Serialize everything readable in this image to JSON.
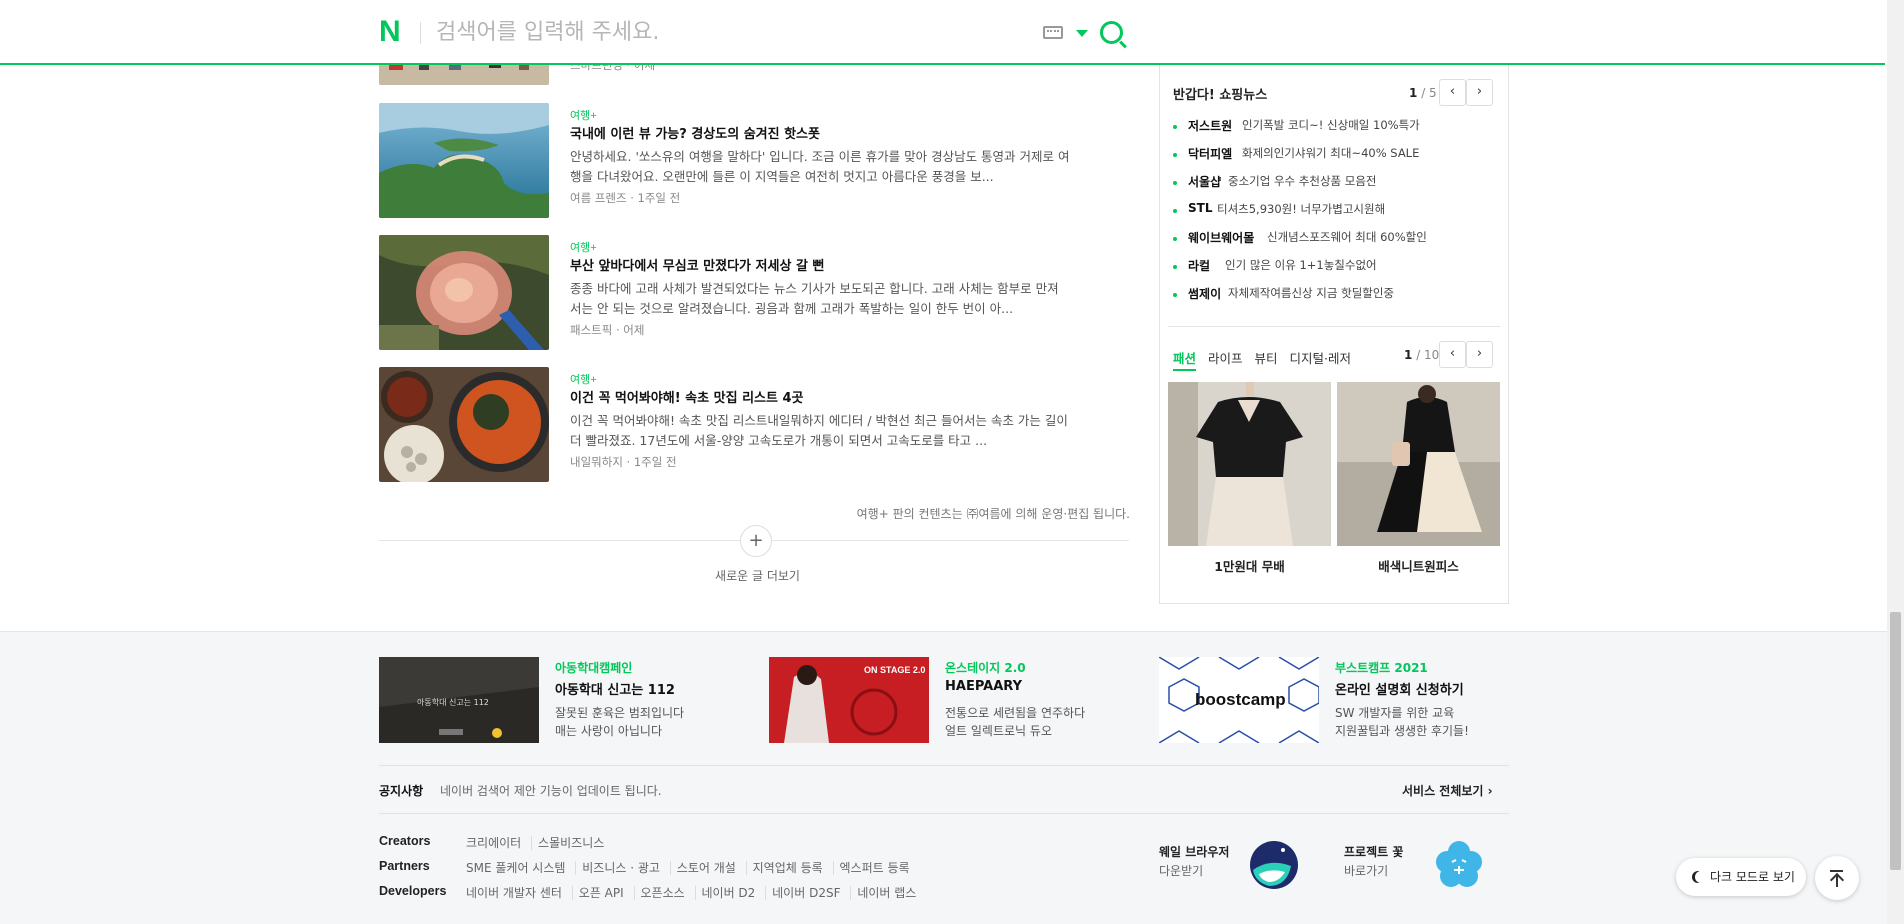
{
  "search": {
    "logo": "N",
    "placeholder": "검색어를 입력해 주세요."
  },
  "articles": [
    {
      "category": "",
      "title": "",
      "desc": "",
      "meta": "스마트런닝 · 어제"
    },
    {
      "category": "여행+",
      "title": "국내에 이런 뷰 가능? 경상도의 숨겨진 핫스폿",
      "desc": "안녕하세요. '쏘스유의 여행을 말하다' 입니다. 조금 이른 휴가를 맞아 경상남도 통영과 거제로 여행을 다녀왔어요. 오랜만에 들른 이 지역들은 여전히 멋지고 아름다운 풍경을 보...",
      "meta": "여름 프렌즈 · 1주일 전"
    },
    {
      "category": "여행+",
      "title": "부산 앞바다에서 무심코 만졌다가 저세상 갈 뻔",
      "desc": "종종 바다에 고래 사체가 발견되었다는 뉴스 기사가 보도되곤 합니다. 고래 사체는 함부로 만져서는 안 되는 것으로 알려졌습니다. 굉음과 함께 고래가 폭발하는 일이 한두 번이 아...",
      "meta": "패스트픽 · 어제"
    },
    {
      "category": "여행+",
      "title": "이건 꼭 먹어봐야해! 속초 맛집 리스트 4곳",
      "desc": "이건 꼭 먹어봐야해! 속초 맛집 리스트내일뭐하지 에디터 / 박현선 최근 들어서는 속초 가는 길이 더 빨라졌죠. 17년도에 서울-양양 고속도로가 개통이 되면서 고속도로를 타고 ...",
      "meta": "내일뭐하지 · 1주일 전"
    }
  ],
  "content_notice": "여행+ 판의 컨텐츠는 ㈜여름에 의해 운영·편집 됩니다.",
  "more": {
    "plus": "+",
    "label": "새로운 글 더보기"
  },
  "shopping": {
    "title": "반갑다! 쇼핑뉴스",
    "page_current": "1",
    "page_total": "/ 5",
    "items": [
      {
        "brand": "저스트원",
        "text": "인기폭발 코디~! 신상매일 10%특가"
      },
      {
        "brand": "닥터피엘",
        "text": "화제의인기샤워기 최대~40% SALE"
      },
      {
        "brand": "서울샵",
        "text": "중소기업 우수 추천상품 모음전"
      },
      {
        "brand": "STL",
        "text": "티셔츠5,930원! 너무가볍고시원해"
      },
      {
        "brand": "웨이브웨어몰",
        "text": "신개념스포즈웨어 최대 60%할인"
      },
      {
        "brand": "라컬",
        "text": "인기 많은 이유 1+1놓칠수없어"
      },
      {
        "brand": "썸제이",
        "text": "자체제작여름신상 지금 핫딜할인중"
      }
    ],
    "tabs": [
      "패션",
      "라이프",
      "뷰티",
      "디지털·레저"
    ],
    "tab_page_current": "1",
    "tab_page_total": "/ 10",
    "products": [
      {
        "name": "1만원대 무배"
      },
      {
        "name": "배색니트원피스"
      }
    ],
    "prev": "‹",
    "next": "›"
  },
  "promos": [
    {
      "category": "아동학대캠페인",
      "title": "아동학대 신고는 112",
      "desc1": "잘못된 훈육은 범죄입니다",
      "desc2": "매는 사랑이 아닙니다",
      "image_text": "아동학대 신고는 112"
    },
    {
      "category": "온스테이지 2.0",
      "title": "HAEPAARY",
      "desc1": "전통으로 세련됨을 연주하다",
      "desc2": "얼트 일렉트로닉 듀오",
      "image_text": "ON STAGE 2.0"
    },
    {
      "category": "부스트캠프 2021",
      "title": "온라인 설명회 신청하기",
      "desc1": "SW 개발자를 위한 교육",
      "desc2": "지원꿀팁과 생생한 후기들!",
      "image_text": "boostcamp"
    }
  ],
  "footer": {
    "notice_label": "공지사항",
    "notice_text": "네이버 검색어 제안 기능이 업데이트 됩니다.",
    "services": "서비스 전체보기",
    "link_rows": [
      {
        "head": "Creators",
        "links": [
          "크리에이터",
          "스몰비즈니스"
        ]
      },
      {
        "head": "Partners",
        "links": [
          "SME 풀케어 시스템",
          "비즈니스 · 광고",
          "스토어 개설",
          "지역업체 등록",
          "엑스퍼트 등록"
        ]
      },
      {
        "head": "Developers",
        "links": [
          "네이버 개발자 센터",
          "오픈 API",
          "오픈소스",
          "네이버 D2",
          "네이버 D2SF",
          "네이버 랩스"
        ]
      }
    ],
    "apps": [
      {
        "name": "웨일 브라우저",
        "sub": "다운받기"
      },
      {
        "name": "프로젝트 꽃",
        "sub": "바로가기"
      }
    ],
    "dark_mode": "다크 모드로 보기"
  },
  "colors": {
    "brand": "#03c75a"
  }
}
